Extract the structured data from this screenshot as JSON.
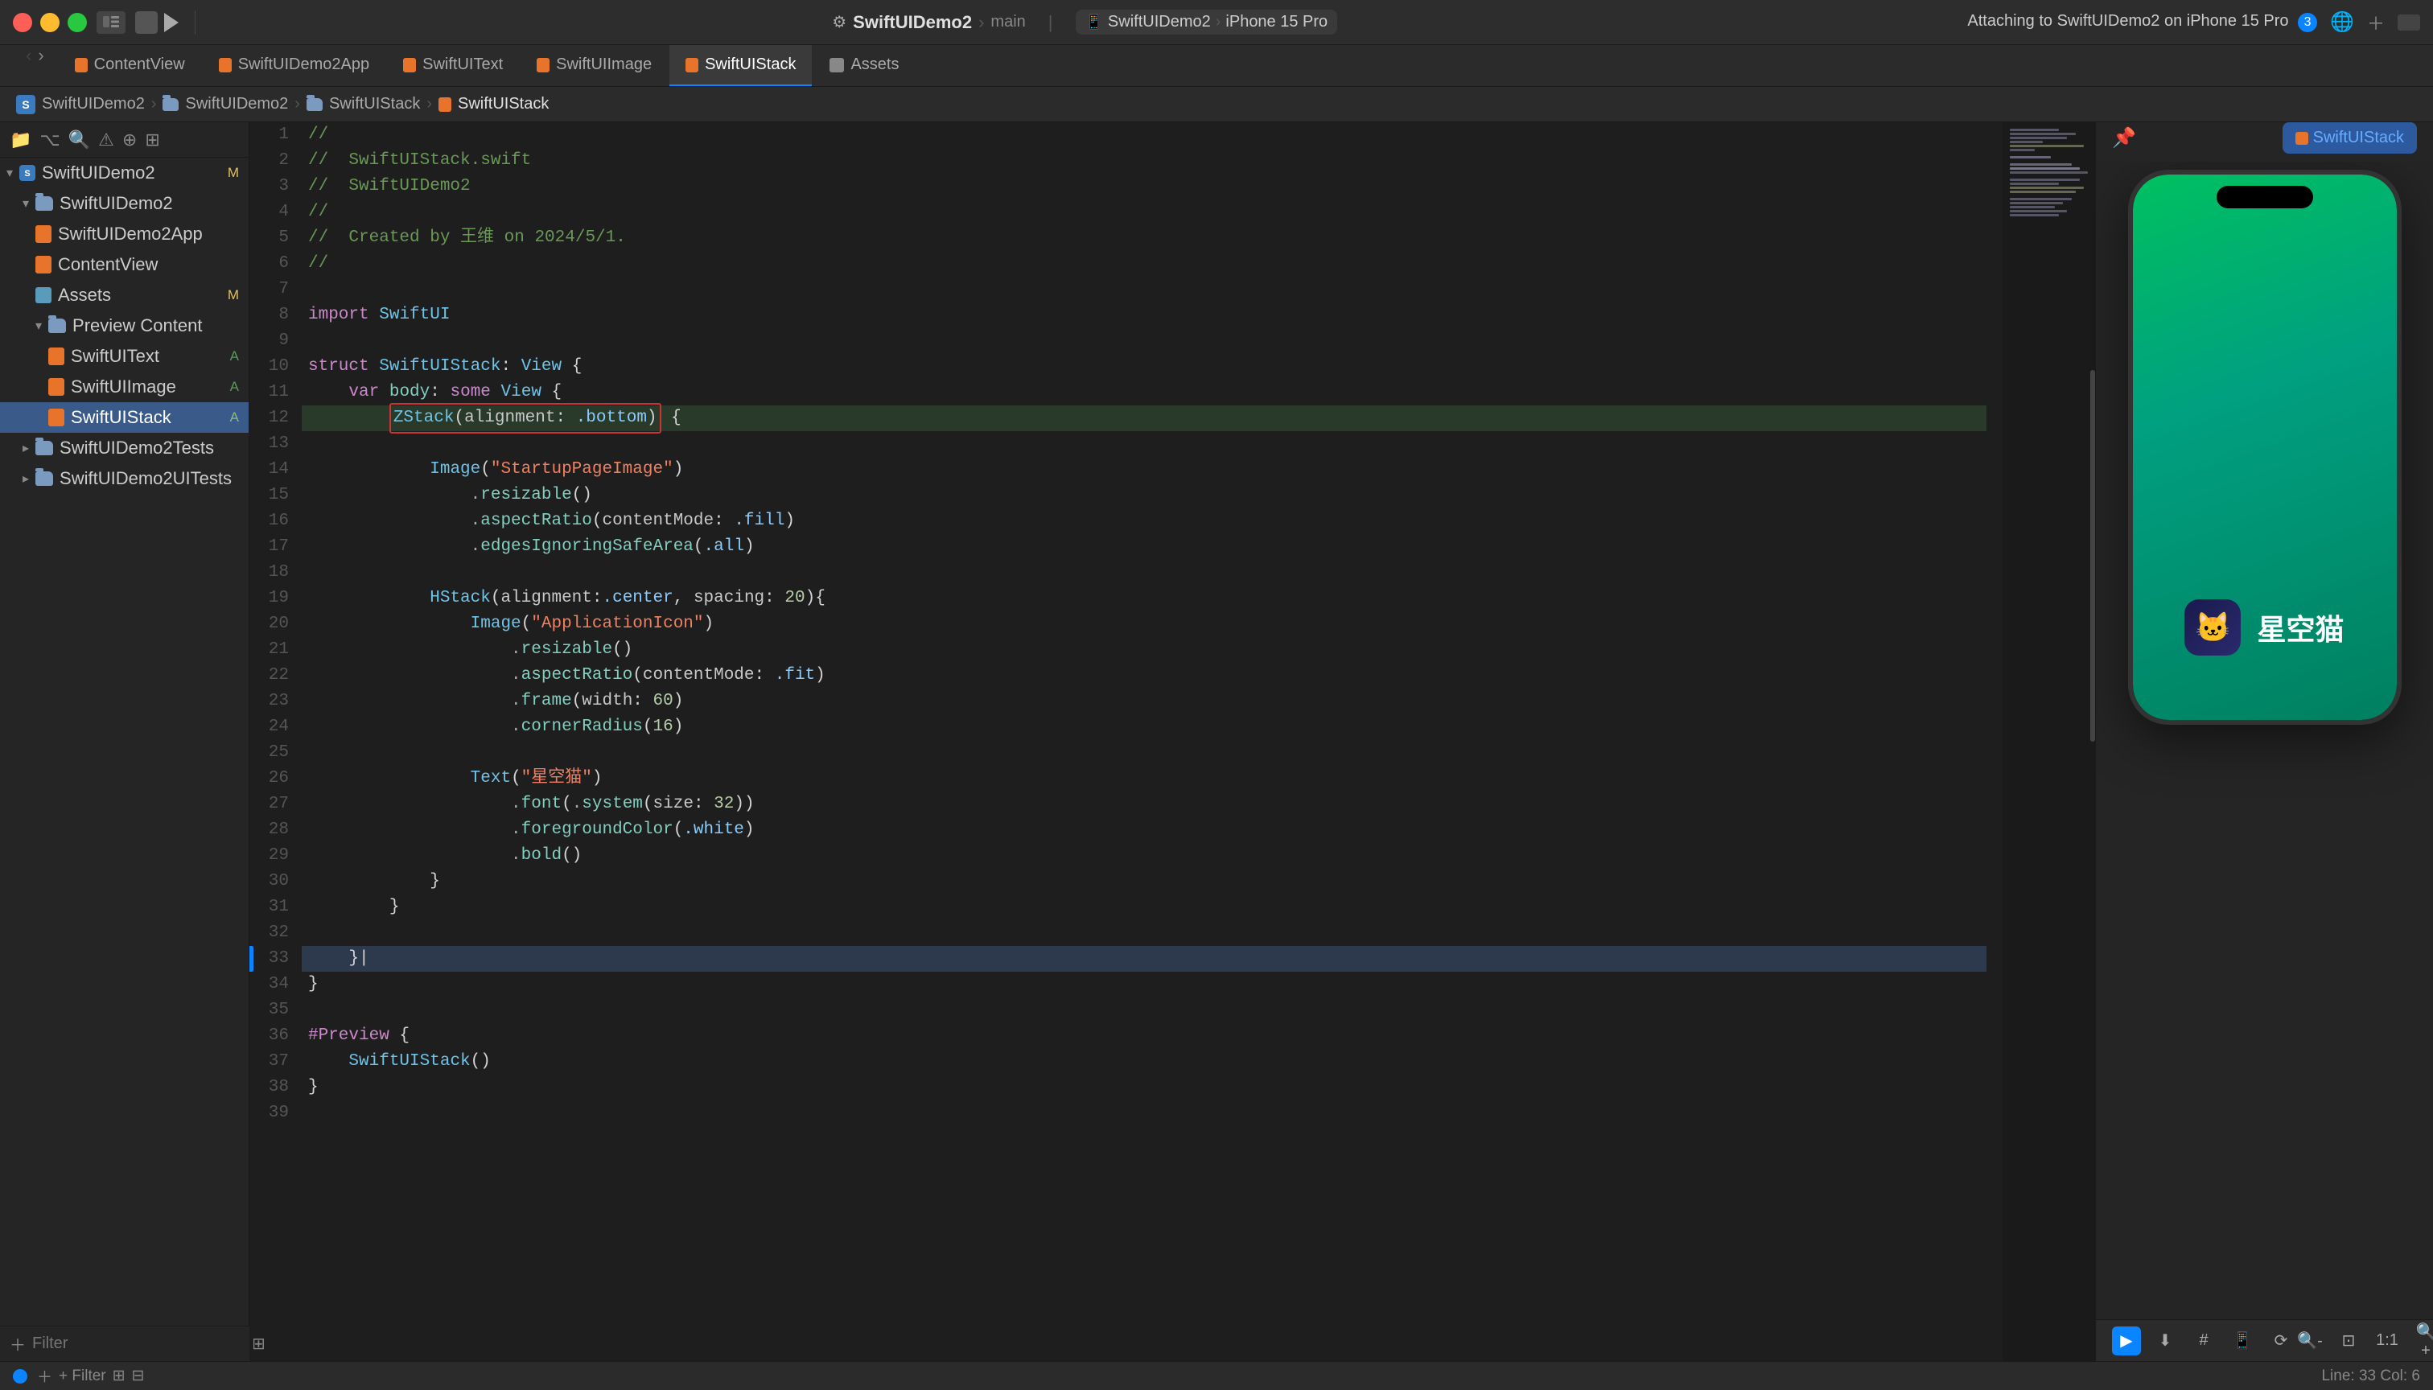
{
  "titlebar": {
    "app_name": "SwiftUIDemo2",
    "sub_name": "main",
    "device": "iPhone 15 Pro",
    "scheme": "SwiftUIDemo2",
    "attach_text": "Attaching to SwiftUIDemo2 on iPhone 15 Pro",
    "attach_count": "3"
  },
  "tabs": [
    {
      "label": "ContentView",
      "icon": "orange"
    },
    {
      "label": "SwiftUIDemo2App",
      "icon": "orange"
    },
    {
      "label": "SwiftUIText",
      "icon": "orange"
    },
    {
      "label": "SwiftUIImage",
      "icon": "orange"
    },
    {
      "label": "SwiftUIStack",
      "icon": "blue",
      "active": true
    },
    {
      "label": "Assets",
      "icon": "blue"
    }
  ],
  "breadcrumb": {
    "items": [
      "SwiftUIDemo2",
      "SwiftUIDemo2",
      "SwiftUIStack",
      "SwiftUIStack"
    ]
  },
  "sidebar": {
    "items": [
      {
        "label": "SwiftUIDemo2",
        "indent": 0,
        "type": "project",
        "badge": "M",
        "expanded": true
      },
      {
        "label": "SwiftUIDemo2",
        "indent": 1,
        "type": "folder",
        "expanded": true
      },
      {
        "label": "SwiftUIDemo2App",
        "indent": 2,
        "type": "file-orange"
      },
      {
        "label": "ContentView",
        "indent": 2,
        "type": "file-orange"
      },
      {
        "label": "Assets",
        "indent": 2,
        "type": "file-blue",
        "badge": "M"
      },
      {
        "label": "Preview Content",
        "indent": 2,
        "type": "folder",
        "expanded": true
      },
      {
        "label": "SwiftUIText",
        "indent": 3,
        "type": "file-orange",
        "badge": "A"
      },
      {
        "label": "SwiftUIImage",
        "indent": 3,
        "type": "file-orange",
        "badge": "A"
      },
      {
        "label": "SwiftUIStack",
        "indent": 3,
        "type": "file-orange",
        "badge": "A",
        "selected": true
      },
      {
        "label": "SwiftUIDemo2Tests",
        "indent": 1,
        "type": "folder",
        "expanded": false
      },
      {
        "label": "SwiftUIDemo2UITests",
        "indent": 1,
        "type": "folder",
        "expanded": false
      }
    ]
  },
  "code": {
    "filename": "SwiftUIStack.swift",
    "project": "SwiftUIDemo2",
    "created": "Created by 王维 on 2024/5/1.",
    "lines": [
      {
        "num": 1,
        "text": "//",
        "tokens": [
          {
            "type": "comment",
            "text": "//"
          }
        ]
      },
      {
        "num": 2,
        "text": "//  SwiftUIStack.swift",
        "tokens": [
          {
            "type": "comment",
            "text": "//  SwiftUIStack.swift"
          }
        ]
      },
      {
        "num": 3,
        "text": "//  SwiftUIDemo2",
        "tokens": [
          {
            "type": "comment",
            "text": "//  SwiftUIDemo2"
          }
        ]
      },
      {
        "num": 4,
        "text": "//",
        "tokens": [
          {
            "type": "comment",
            "text": "//"
          }
        ]
      },
      {
        "num": 5,
        "text": "//  Created by 王维 on 2024/5/1.",
        "tokens": [
          {
            "type": "comment",
            "text": "//  Created by 王维 on 2024/5/1."
          }
        ]
      },
      {
        "num": 6,
        "text": "//",
        "tokens": [
          {
            "type": "comment",
            "text": "//"
          }
        ]
      },
      {
        "num": 7,
        "text": ""
      },
      {
        "num": 8,
        "text": "import SwiftUI"
      },
      {
        "num": 9,
        "text": ""
      },
      {
        "num": 10,
        "text": "struct SwiftUIStack: View {"
      },
      {
        "num": 11,
        "text": "    var body: some View {"
      },
      {
        "num": 12,
        "text": "        ZStack(alignment: .bottom) {",
        "highlighted": true
      },
      {
        "num": 13,
        "text": ""
      },
      {
        "num": 14,
        "text": "            Image(\"StartupPageImage\")"
      },
      {
        "num": 15,
        "text": "                .resizable()"
      },
      {
        "num": 16,
        "text": "                .aspectRatio(contentMode: .fill)"
      },
      {
        "num": 17,
        "text": "                .edgesIgnoringSafeArea(.all)"
      },
      {
        "num": 18,
        "text": ""
      },
      {
        "num": 19,
        "text": "            HStack(alignment:.center, spacing: 20){"
      },
      {
        "num": 20,
        "text": "                Image(\"ApplicationIcon\")"
      },
      {
        "num": 21,
        "text": "                    .resizable()"
      },
      {
        "num": 22,
        "text": "                    .aspectRatio(contentMode: .fit)"
      },
      {
        "num": 23,
        "text": "                    .frame(width: 60)"
      },
      {
        "num": 24,
        "text": "                    .cornerRadius(16)"
      },
      {
        "num": 25,
        "text": ""
      },
      {
        "num": 26,
        "text": "                Text(\"星空猫\")"
      },
      {
        "num": 27,
        "text": "                    .font(.system(size: 32))"
      },
      {
        "num": 28,
        "text": "                    .foregroundColor(.white)"
      },
      {
        "num": 29,
        "text": "                    .bold()"
      },
      {
        "num": 30,
        "text": "            }"
      },
      {
        "num": 31,
        "text": "        }"
      },
      {
        "num": 32,
        "text": ""
      },
      {
        "num": 33,
        "text": "    }",
        "current": true
      },
      {
        "num": 34,
        "text": "}"
      },
      {
        "num": 35,
        "text": ""
      },
      {
        "num": 36,
        "text": "#Preview {"
      },
      {
        "num": 37,
        "text": "    SwiftUIStack()"
      },
      {
        "num": 38,
        "text": "}"
      },
      {
        "num": 39,
        "text": ""
      }
    ]
  },
  "preview": {
    "pin_label": "📌",
    "component_name": "SwiftUIStack",
    "app_text": "星空猫",
    "play_btn": "▶",
    "zoom_label": "100%"
  },
  "statusbar": {
    "filter_placeholder": "+ Filter",
    "line_col": "Line: 33  Col: 6"
  }
}
